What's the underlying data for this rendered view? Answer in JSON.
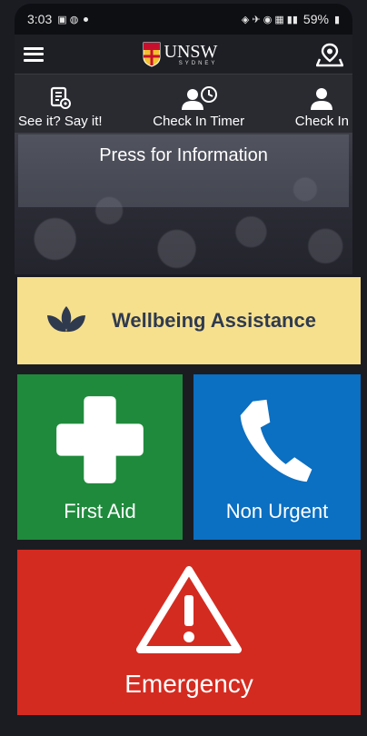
{
  "status_bar": {
    "time": "3:03",
    "battery": "59%"
  },
  "header": {
    "logo_main": "UNSW",
    "logo_sub": "SYDNEY"
  },
  "quick_actions": [
    {
      "label": "See it? Say it!",
      "icon": "report-icon"
    },
    {
      "label": "Check In Timer",
      "icon": "person-clock-icon"
    },
    {
      "label": "Check In",
      "icon": "person-icon"
    }
  ],
  "info_banner": {
    "text": "Press for Information"
  },
  "tiles": {
    "wellbeing": {
      "label": "Wellbeing Assistance",
      "icon": "lotus-icon",
      "color": "#f6e08e"
    },
    "first_aid": {
      "label": "First Aid",
      "icon": "cross-icon",
      "color": "#1f8a3c"
    },
    "non_urgent": {
      "label": "Non Urgent",
      "icon": "phone-icon",
      "color": "#0b6fc2"
    },
    "emergency": {
      "label": "Emergency",
      "icon": "warning-icon",
      "color": "#d42b21"
    }
  }
}
